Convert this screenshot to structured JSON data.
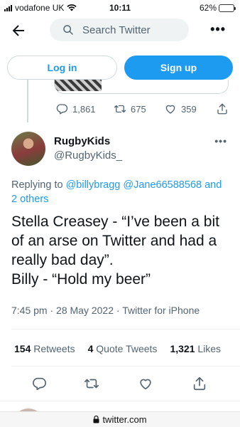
{
  "status_bar": {
    "carrier": "vodafone UK",
    "time": "10:11",
    "battery": "62%",
    "battery_level": 0.62
  },
  "nav": {
    "search_placeholder": "Search Twitter",
    "more_label": "•••"
  },
  "auth": {
    "login": "Log in",
    "signup": "Sign up"
  },
  "previous_tweet": {
    "replies": "1,861",
    "retweets": "675",
    "likes": "359"
  },
  "tweet": {
    "display_name": "RugbyKids",
    "handle": "@RugbyKids_",
    "more_label": "•••",
    "replying_prefix": "Replying to",
    "replying_mentions": "@billybragg @Jane66588568",
    "replying_and": "and",
    "replying_others": "2 others",
    "text": "Stella Creasey - “I’ve been a bit of an arse on Twitter and had a really bad day”.\nBilly - “Hold my beer”",
    "time": "7:45 pm",
    "date": "28 May 2022",
    "source": "Twitter for iPhone",
    "stats": {
      "retweets_count": "154",
      "retweets_label": "Retweets",
      "quotes_count": "4",
      "quotes_label": "Quote Tweets",
      "likes_count": "1,321",
      "likes_label": "Likes"
    }
  },
  "browser": {
    "url": "twitter.com"
  },
  "colors": {
    "accent": "#1d9bf0",
    "text": "#0f1419",
    "muted": "#536471"
  }
}
